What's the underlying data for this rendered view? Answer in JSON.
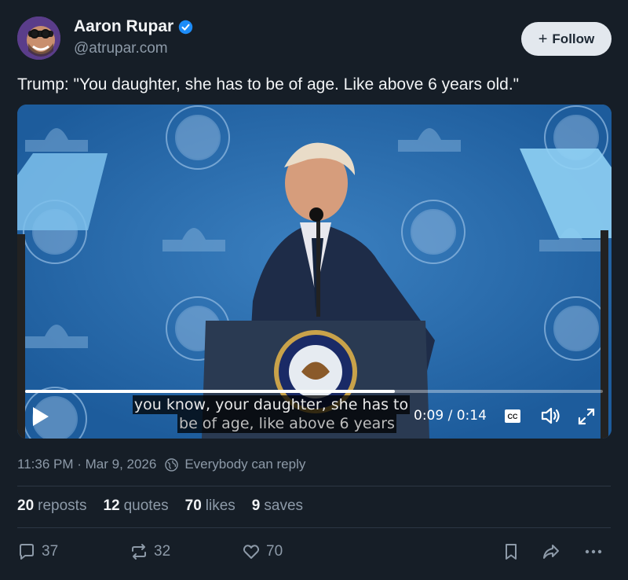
{
  "author": {
    "name": "Aaron Rupar",
    "handle": "@atrupar.com",
    "verified": true
  },
  "follow_button": {
    "label": "Follow"
  },
  "post": {
    "text": "Trump: \"You daughter, she has to be of age. Like above 6 years old.\""
  },
  "video": {
    "captions": [
      "you know, your daughter, she has to",
      "be of age, like above 6 years"
    ],
    "time": "0:09 / 0:14",
    "progress": 0.64,
    "cc_label": "CC"
  },
  "meta": {
    "timestamp": "11:36 PM · Mar 9, 2026",
    "reply_setting": "Everybody can reply"
  },
  "stats": {
    "reposts_count": "20",
    "reposts_label": "reposts",
    "quotes_count": "12",
    "quotes_label": "quotes",
    "likes_count": "70",
    "likes_label": "likes",
    "saves_count": "9",
    "saves_label": "saves"
  },
  "actions": {
    "reply_count": "37",
    "repost_count": "32",
    "like_count": "70"
  },
  "colors": {
    "background": "#161e27",
    "accent_verified": "#1d8cf8",
    "muted": "#8d9aa8"
  }
}
